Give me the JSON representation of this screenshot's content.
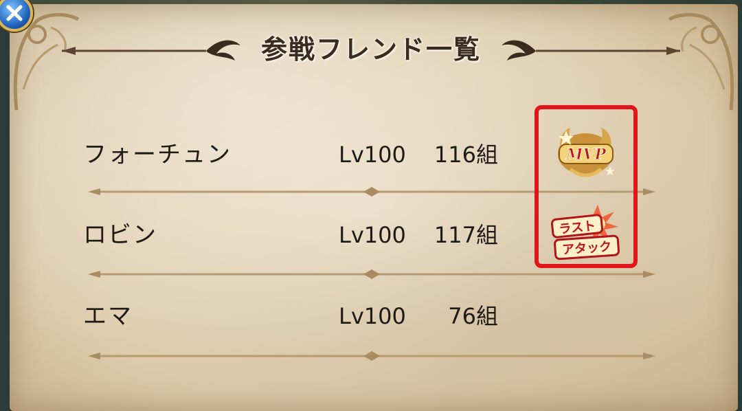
{
  "dialog": {
    "title": "参戦フレンド一覧",
    "close_icon": "close-x-icon"
  },
  "friends": [
    {
      "name": "フォーチュン",
      "level": "Lv100",
      "count": "116組",
      "badge": "MVP"
    },
    {
      "name": "ロビン",
      "level": "Lv100",
      "count": "117組",
      "badge": "ラスト アタック"
    },
    {
      "name": "エマ",
      "level": "Lv100",
      "count": "76組",
      "badge": ""
    }
  ],
  "badges": {
    "mvp_text": "MVP",
    "last_attack_line1": "ラスト",
    "last_attack_line2": "アタック"
  },
  "colors": {
    "highlight_border": "#e3141b",
    "parchment": "#e6d6b8",
    "text": "#1e1a16",
    "close_button": "#1d5fb8"
  }
}
